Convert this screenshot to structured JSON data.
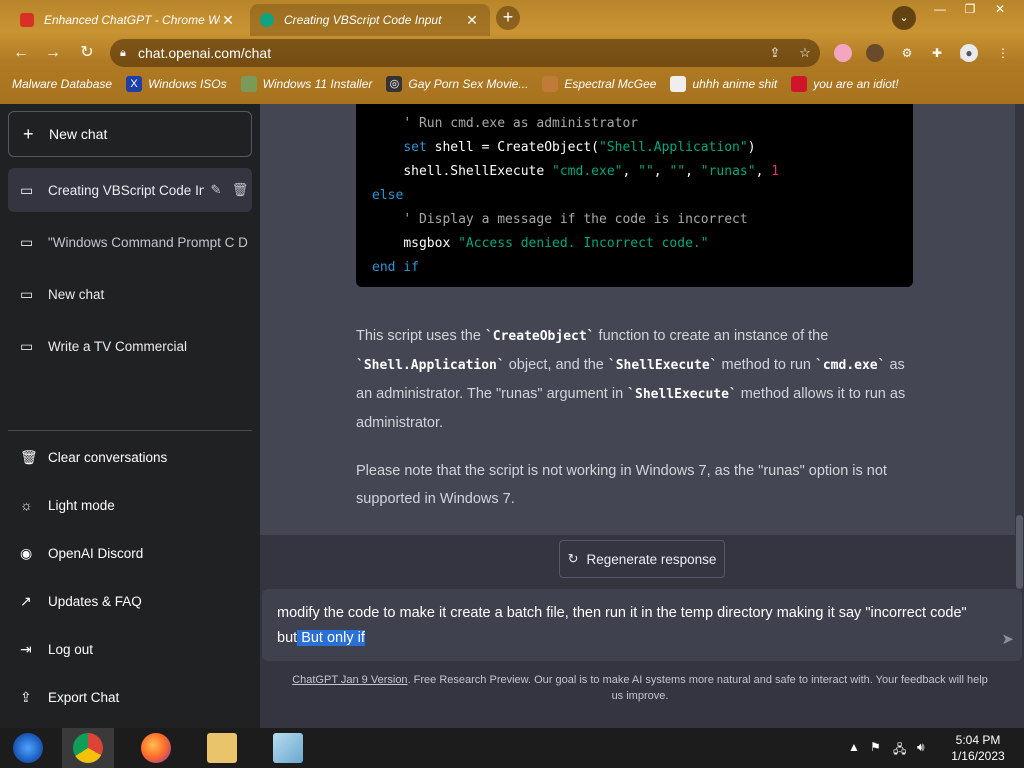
{
  "browser": {
    "tabs": [
      {
        "title": "Enhanced ChatGPT - Chrome Web"
      },
      {
        "title": "Creating VBScript Code Input"
      }
    ],
    "new_tab_label": "+",
    "url": "chat.openai.com/chat",
    "bookmarks": [
      {
        "label": "Malware Database"
      },
      {
        "label": "Windows ISOs"
      },
      {
        "label": "Windows 11 Installer"
      },
      {
        "label": "Gay Porn Sex Movie..."
      },
      {
        "label": "Espectral McGee"
      },
      {
        "label": "uhhh anime shit"
      },
      {
        "label": "you are an idiot!"
      }
    ]
  },
  "sidebar": {
    "new_chat": "New chat",
    "chats": [
      {
        "label": "Creating VBScript Code In"
      },
      {
        "label": "\"Windows Command Prompt C D"
      },
      {
        "label": "New chat"
      },
      {
        "label": "Write a TV Commercial"
      }
    ],
    "links": [
      {
        "label": "Clear conversations"
      },
      {
        "label": "Light mode"
      },
      {
        "label": "OpenAI Discord"
      },
      {
        "label": "Updates & FAQ"
      },
      {
        "label": "Log out"
      },
      {
        "label": "Export Chat"
      }
    ]
  },
  "code": {
    "line1_comment": "' Run cmd.exe as administrator",
    "line2_kw": "set",
    "line2_a": " shell = CreateObject(",
    "line2_str": "\"Shell.Application\"",
    "line2_b": ")",
    "line3_a": "shell.ShellExecute ",
    "line3_s1": "\"cmd.exe\"",
    "line3_c1": ", ",
    "line3_s2": "\"\"",
    "line3_c2": ", ",
    "line3_s3": "\"\"",
    "line3_c3": ", ",
    "line3_s4": "\"runas\"",
    "line3_c4": ", ",
    "line3_num": "1",
    "line4_kw": "else",
    "line5_comment": "' Display a message if the code is incorrect",
    "line6_a": "msgbox ",
    "line6_str": "\"Access denied. Incorrect code.\"",
    "line7_kw": "end if"
  },
  "answer": {
    "p1_a": "This script uses the ",
    "p1_code1": "`CreateObject`",
    "p1_b": " function to create an instance of the ",
    "p1_code2": "`Shell.Application`",
    "p1_c": " object, and the ",
    "p1_code3": "`ShellExecute`",
    "p1_d": " method to run ",
    "p1_code4": "`cmd.exe`",
    "p1_e": " as an administrator. The \"runas\" argument in ",
    "p1_code5": "`ShellExecute`",
    "p1_f": " method allows it to run as administrator.",
    "p2": "Please note that the script is not working in Windows 7, as the \"runas\" option is not supported in Windows 7."
  },
  "composer": {
    "regenerate": "Regenerate response",
    "text_main": "modify the code to make it create a batch file, then run it in the temp directory making it say \"incorrect code\" but",
    "text_selected": " But only if"
  },
  "footer": {
    "link": "ChatGPT Jan 9 Version",
    "text": ". Free Research Preview. Our goal is to make AI systems more natural and safe to interact with. Your feedback will help us improve."
  },
  "taskbar": {
    "time": "5:04 PM",
    "date": "1/16/2023"
  },
  "colors": {
    "sidebar_bg": "#202123",
    "main_bg": "#444654",
    "composer_bg": "#343541",
    "selection": "#2a6fd6"
  }
}
